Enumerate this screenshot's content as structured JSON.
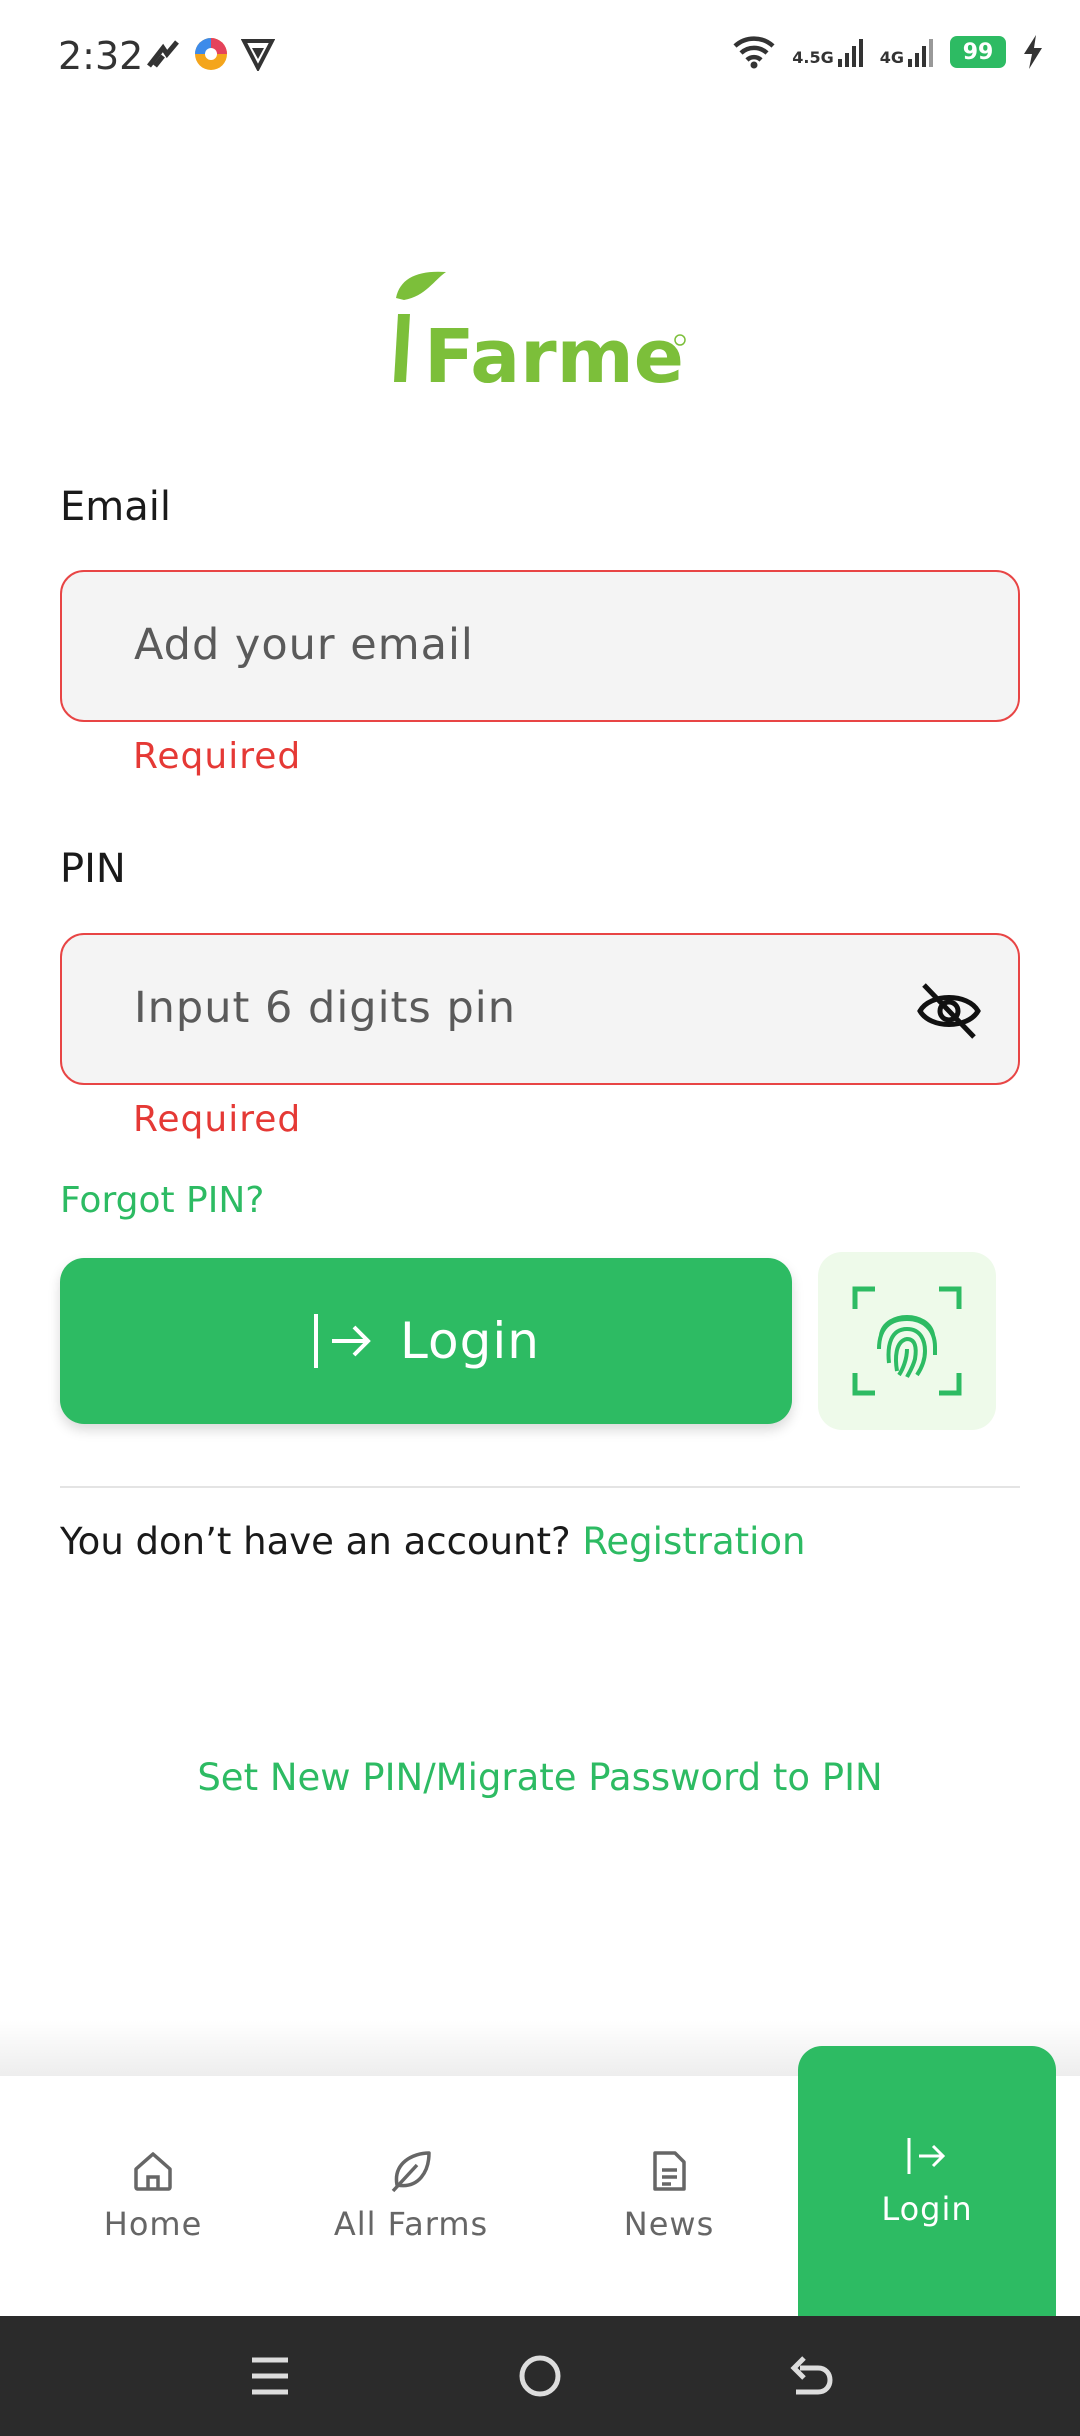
{
  "status_bar": {
    "time": "2:32",
    "signal_1_label": "4.5G",
    "signal_2_label": "4G",
    "battery": "99",
    "icons": [
      "notification-icon",
      "app-icon",
      "vpn-icon",
      "wifi-icon",
      "signal-icon",
      "signal-icon",
      "battery-icon",
      "charging-icon"
    ]
  },
  "logo": {
    "text": "Farmer"
  },
  "form": {
    "email_label": "Email",
    "email_placeholder": "Add your email",
    "email_error": "Required",
    "pin_label": "PIN",
    "pin_placeholder": "Input 6 digits pin",
    "pin_error": "Required",
    "forgot_pin": "Forgot PIN?",
    "login_button": "Login",
    "no_account_text": "You don’t have an account? ",
    "registration_link": "Registration",
    "migrate_link": "Set New PIN/Migrate Password to PIN"
  },
  "bottom_nav": {
    "items": [
      {
        "label": "Home",
        "icon": "home-icon",
        "active": false
      },
      {
        "label": "All Farms",
        "icon": "leaf-icon",
        "active": false
      },
      {
        "label": "News",
        "icon": "document-icon",
        "active": false
      },
      {
        "label": "Login",
        "icon": "login-icon",
        "active": true
      }
    ]
  },
  "colors": {
    "brand_green": "#2dbb63",
    "logo_green": "#7cbf3a",
    "error_red": "#e53935",
    "field_bg": "#f4f4f4"
  }
}
